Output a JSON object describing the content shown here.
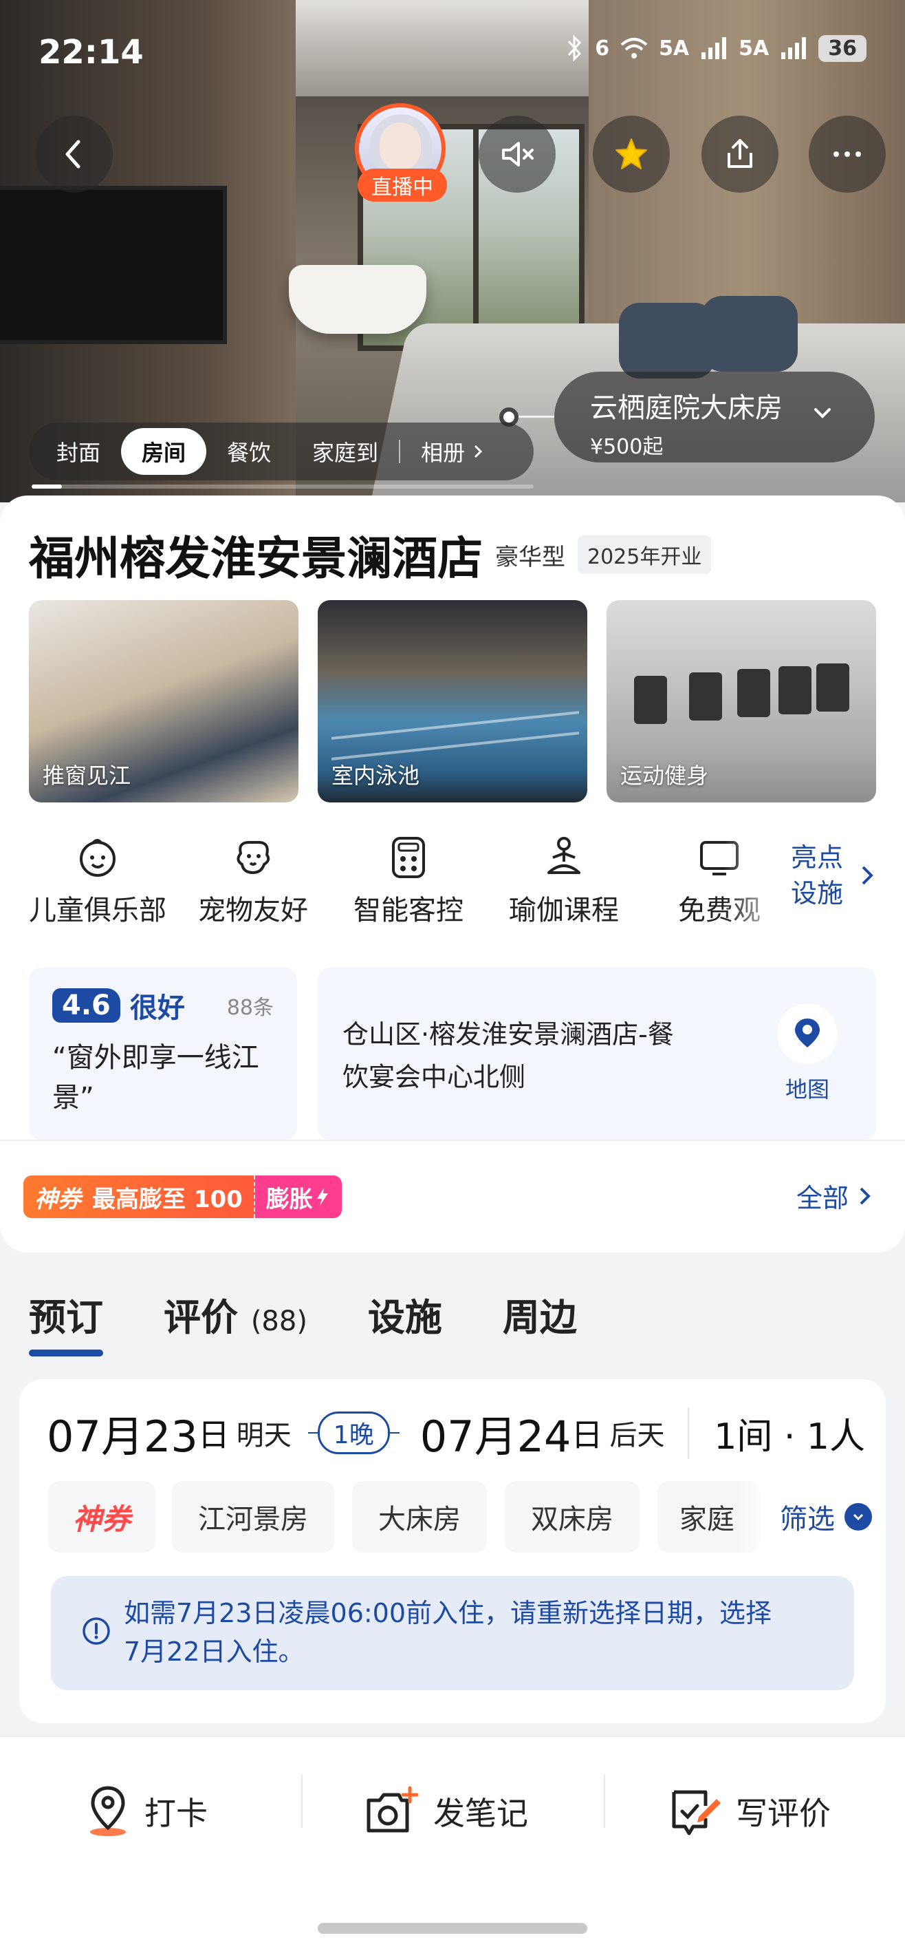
{
  "status_bar": {
    "time": "22:14",
    "signal_1": "5A",
    "signal_2": "5A",
    "wifi_label": "6",
    "battery": "36"
  },
  "hero": {
    "live_badge": "直播中",
    "room_pill": {
      "name": "云栖庭院大床房",
      "price": "¥500起"
    },
    "tabs": [
      "封面",
      "房间",
      "餐饮",
      "家庭到",
      "相册"
    ],
    "active_tab": "房间",
    "progress": 0.06
  },
  "hotel": {
    "name": "福州榕发淮安景澜酒店",
    "grade": "豪华型",
    "opened": "2025年开业"
  },
  "photos": [
    {
      "caption": "推窗见江"
    },
    {
      "caption": "室内泳池"
    },
    {
      "caption": "运动健身"
    }
  ],
  "amenities": [
    {
      "label": "儿童俱乐部",
      "icon": "child-face-icon"
    },
    {
      "label": "宠物友好",
      "icon": "dog-icon"
    },
    {
      "label": "智能客控",
      "icon": "smart-control-icon"
    },
    {
      "label": "瑜伽课程",
      "icon": "yoga-icon"
    },
    {
      "label": "免费观",
      "icon": "tv-icon"
    }
  ],
  "amenity_more": {
    "line1": "亮点",
    "line2": "设施"
  },
  "rating": {
    "score": "4.6",
    "word": "很好",
    "count": "88条",
    "quote_line1": "“窗外即享一线江",
    "quote_line2": "景”"
  },
  "address": {
    "line1": "仓山区·榕发淮安景澜酒店-餐",
    "line2": "饮宴会中心北侧",
    "map_label": "地图"
  },
  "coupon": {
    "tag": "神券",
    "text": "最高膨至 100",
    "action": "膨胀"
  },
  "all_link": "全部",
  "section_tabs": [
    {
      "label": "预订",
      "count": ""
    },
    {
      "label": "评价",
      "count": "(88)"
    },
    {
      "label": "设施",
      "count": ""
    },
    {
      "label": "周边",
      "count": ""
    }
  ],
  "booking": {
    "checkin": {
      "month_day": "07月23",
      "unit": "日",
      "rel": "明天"
    },
    "nights": "1晚",
    "checkout": {
      "month_day": "07月24",
      "unit": "日",
      "rel": "后天"
    },
    "guests": "1间 · 1人",
    "chips": [
      "神券",
      "江河景房",
      "大床房",
      "双床房",
      "家庭"
    ],
    "filter": "筛选",
    "notice_line1": "如需7月23日凌晨06:00前入住，请重新选择日期，选择",
    "notice_line2": "7月22日入住。"
  },
  "bottom_actions": [
    {
      "label": "打卡",
      "icon": "location-pin-icon"
    },
    {
      "label": "发笔记",
      "icon": "camera-plus-icon"
    },
    {
      "label": "写评价",
      "icon": "edit-review-icon"
    }
  ],
  "colors": {
    "brand_blue": "#1d4ba3",
    "coupon_orange": "#ff5a3a",
    "coupon_pink": "#ff3d8e",
    "live_orange": "#ff5a2a"
  }
}
